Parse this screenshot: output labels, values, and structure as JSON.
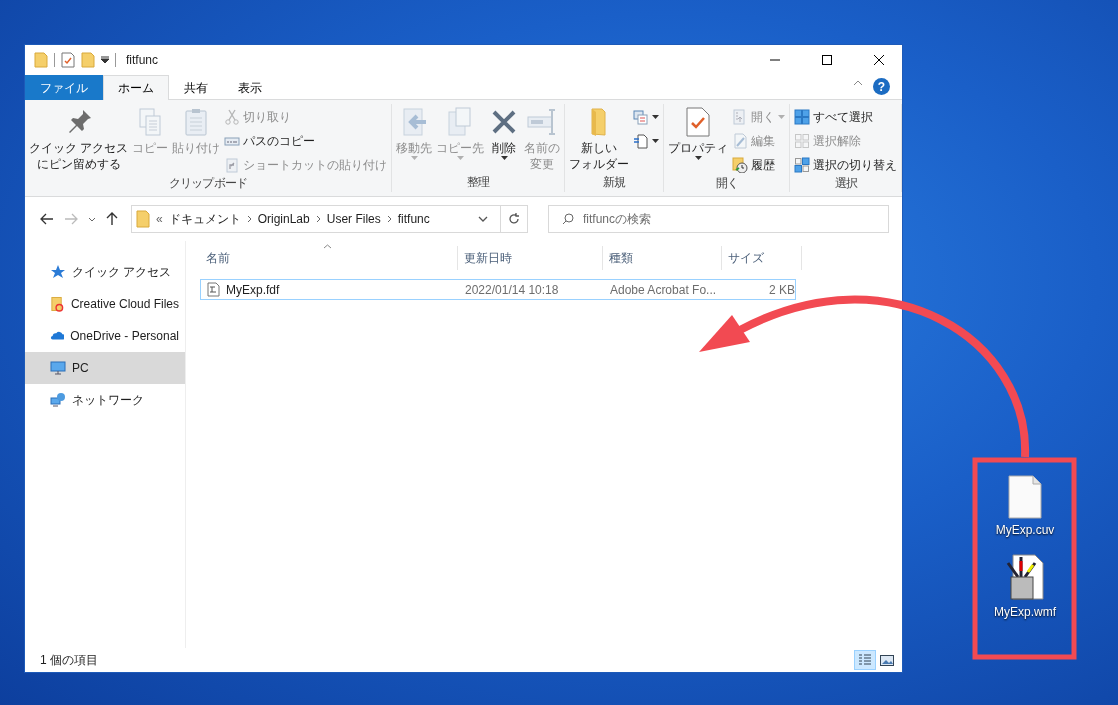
{
  "window": {
    "title": "fitfunc"
  },
  "ribbon_tabs": [
    {
      "label": "ファイル",
      "kind": "file",
      "selected": false
    },
    {
      "label": "ホーム",
      "kind": "tab",
      "selected": true
    },
    {
      "label": "共有",
      "kind": "tab",
      "selected": false
    },
    {
      "label": "表示",
      "kind": "tab",
      "selected": false
    }
  ],
  "help": "?",
  "ribbon_groups": [
    {
      "label": "クリップボード",
      "columns": [
        {
          "kind": "large",
          "lines": [
            "クイック アクセス",
            "にピン留めする"
          ],
          "disabled": false,
          "dropdown": false
        },
        {
          "kind": "large",
          "lines": [
            "コピー"
          ],
          "disabled": true,
          "dropdown": false
        },
        {
          "kind": "large",
          "lines": [
            "貼り付け"
          ],
          "disabled": true,
          "dropdown": false
        },
        {
          "kind": "stack",
          "items": [
            {
              "label": "切り取り",
              "disabled": true,
              "dropdown": false
            },
            {
              "label": "パスのコピー",
              "disabled": false,
              "dropdown": false
            },
            {
              "label": "ショートカットの貼り付け",
              "disabled": true,
              "dropdown": false
            }
          ]
        }
      ]
    },
    {
      "label": "整理",
      "columns": [
        {
          "kind": "large",
          "lines": [
            "移動先"
          ],
          "disabled": true,
          "dropdown": true
        },
        {
          "kind": "large",
          "lines": [
            "コピー先"
          ],
          "disabled": true,
          "dropdown": true
        },
        {
          "kind": "large",
          "lines": [
            "削除"
          ],
          "disabled": false,
          "dropdown": true
        },
        {
          "kind": "large",
          "lines": [
            "名前の",
            "変更"
          ],
          "disabled": true,
          "dropdown": false
        }
      ]
    },
    {
      "label": "新規",
      "columns": [
        {
          "kind": "large",
          "lines": [
            "新しい",
            "フォルダー"
          ],
          "disabled": false,
          "dropdown": false
        },
        {
          "kind": "stack",
          "items": [
            {
              "disabled": false,
              "dropdown": true
            },
            {
              "disabled": false,
              "dropdown": true
            }
          ]
        }
      ]
    },
    {
      "label": "開く",
      "columns": [
        {
          "kind": "large",
          "lines": [
            "プロパティ"
          ],
          "disabled": false,
          "dropdown": true
        },
        {
          "kind": "stack",
          "items": [
            {
              "label": "開く",
              "disabled": true,
              "dropdown": true
            },
            {
              "label": "編集",
              "disabled": true,
              "dropdown": false
            },
            {
              "label": "履歴",
              "disabled": false,
              "dropdown": false
            }
          ]
        }
      ]
    },
    {
      "label": "選択",
      "columns": [
        {
          "kind": "stack",
          "items": [
            {
              "label": "すべて選択",
              "disabled": false,
              "dropdown": false
            },
            {
              "label": "選択解除",
              "disabled": true,
              "dropdown": false
            },
            {
              "label": "選択の切り替え",
              "disabled": false,
              "dropdown": false
            }
          ]
        }
      ]
    }
  ],
  "nav": {
    "back_disabled": false,
    "forward_disabled": true
  },
  "address": {
    "overflow": "«",
    "segments": [
      "ドキュメント",
      "OriginLab",
      "User Files",
      "fitfunc"
    ]
  },
  "search": {
    "placeholder": "fitfuncの検索"
  },
  "sidebar": {
    "items": [
      {
        "label": "クイック アクセス",
        "selected": false
      },
      {
        "label": "Creative Cloud Files",
        "selected": false
      },
      {
        "label": "OneDrive - Personal",
        "selected": false
      },
      {
        "label": "PC",
        "selected": true
      },
      {
        "label": "ネットワーク",
        "selected": false
      }
    ]
  },
  "table": {
    "columns": [
      "名前",
      "更新日時",
      "種類",
      "サイズ"
    ],
    "rows": [
      {
        "cells": [
          "MyExp.fdf",
          "2022/01/14 10:18",
          "Adobe Acrobat Fo...",
          "2 KB"
        ],
        "focused": true
      }
    ]
  },
  "status_bar": {
    "text": "1 個の項目",
    "views": [
      {
        "kind": "details",
        "selected": true
      },
      {
        "kind": "large",
        "selected": false
      }
    ]
  },
  "desktop_icons": [
    {
      "label": "MyExp.cuv",
      "kind": "blank"
    },
    {
      "label": "MyExp.wmf",
      "kind": "picture"
    }
  ]
}
